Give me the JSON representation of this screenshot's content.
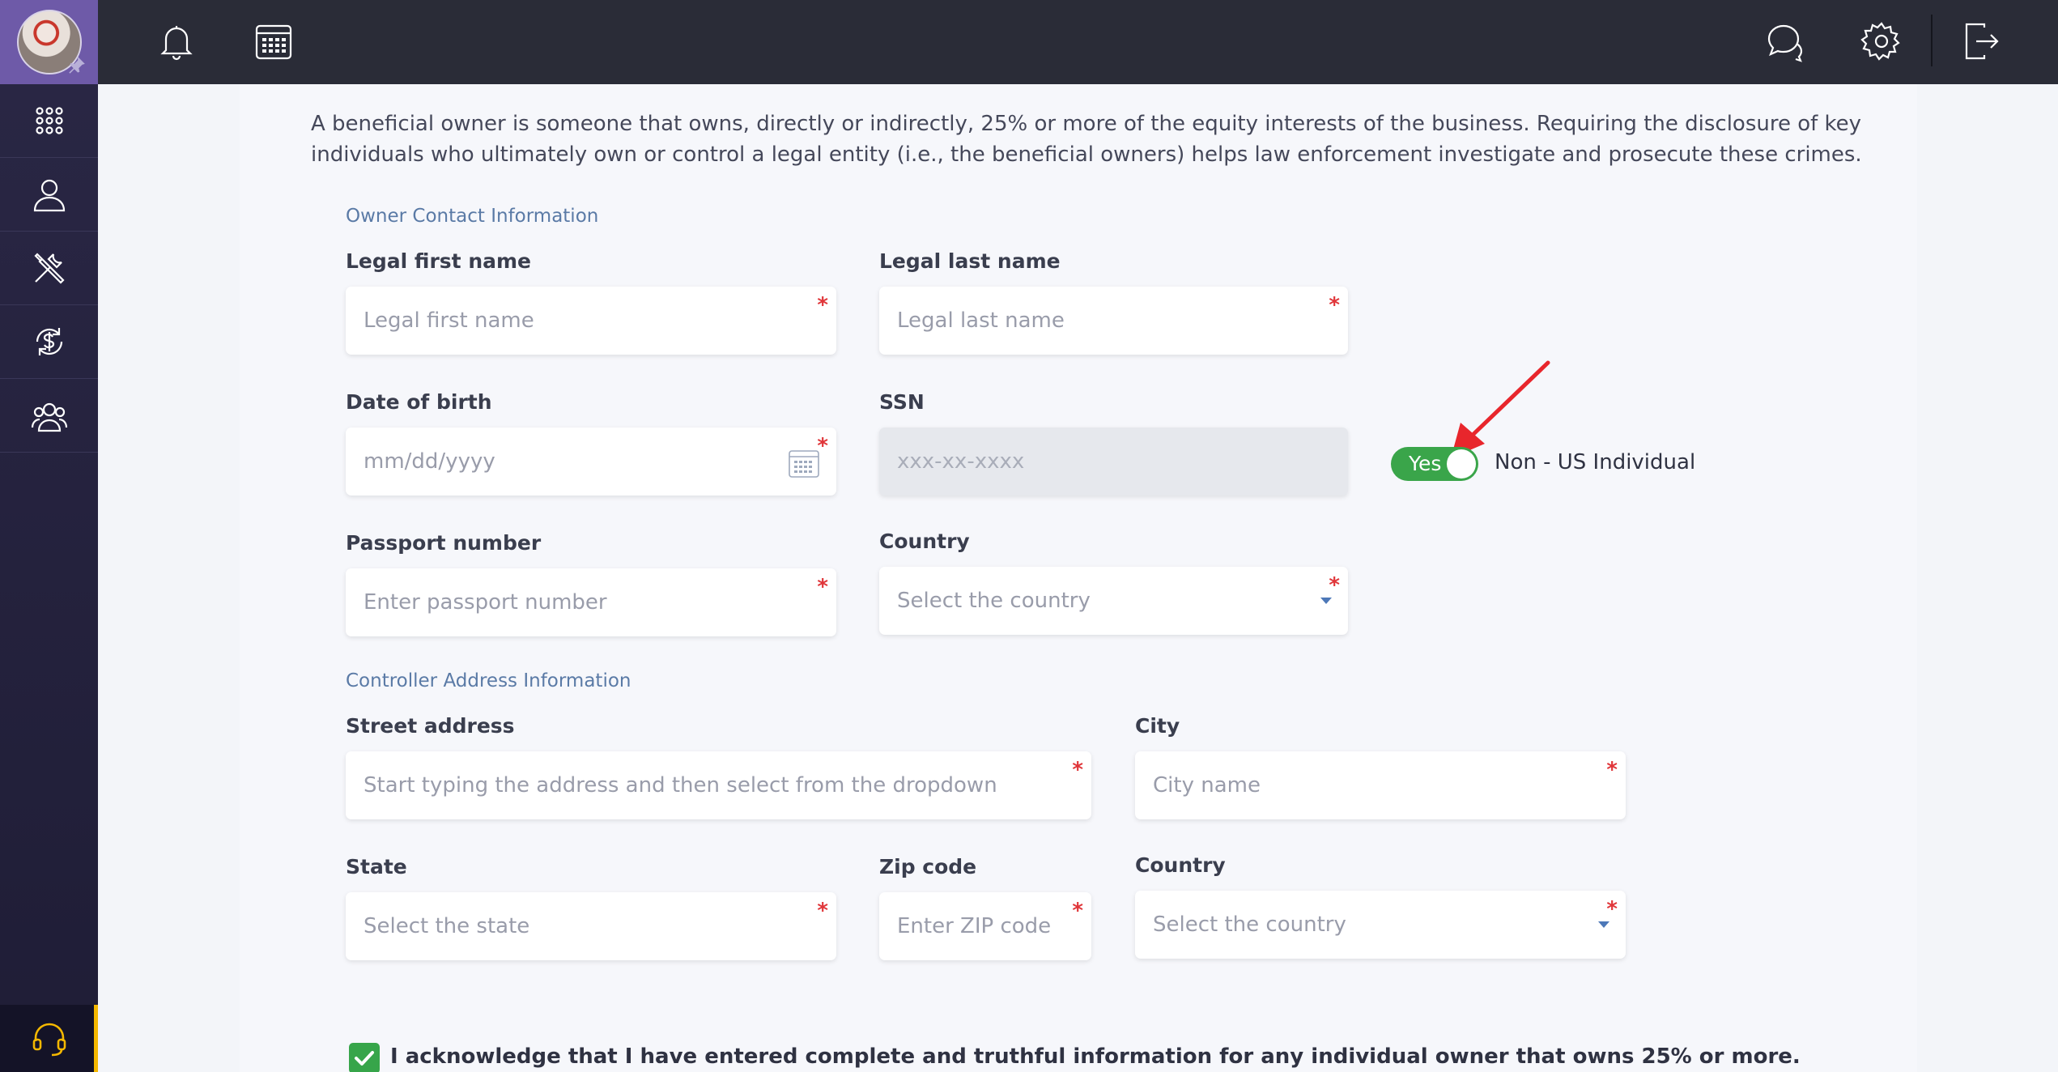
{
  "icons": {
    "notifications": "bell-icon",
    "calendar": "calendar-icon",
    "chat": "chat-icon",
    "settings": "gear-icon",
    "logout": "logout-icon",
    "apps": "apps-grid-icon",
    "profile": "user-icon",
    "tools": "tools-icon",
    "payments": "dollar-refresh-icon",
    "team": "users-icon",
    "support": "headset-icon"
  },
  "colors": {
    "accent": "#3aa54a",
    "section": "#5a7aa6",
    "required": "#e0363a"
  },
  "intro": "A beneficial owner is someone that owns, directly or indirectly, 25% or more of the equity interests of the business. Requiring the disclosure of key individuals who ultimately own or control a legal entity (i.e., the beneficial owners) helps law enforcement investigate and prosecute these crimes.",
  "owner_section": {
    "title": "Owner Contact Information",
    "first_name": {
      "label": "Legal first name",
      "placeholder": "Legal first name",
      "required": "*"
    },
    "last_name": {
      "label": "Legal last name",
      "placeholder": "Legal last name",
      "required": "*"
    },
    "dob": {
      "label": "Date of birth",
      "placeholder": "mm/dd/yyyy",
      "required": "*"
    },
    "ssn": {
      "label": "SSN",
      "placeholder": "xxx-xx-xxxx"
    },
    "non_us": {
      "toggle_text": "Yes",
      "label": "Non - US Individual",
      "on": true
    },
    "passport": {
      "label": "Passport number",
      "placeholder": "Enter passport number",
      "required": "*"
    },
    "country": {
      "label": "Country",
      "placeholder": "Select the country",
      "required": "*"
    }
  },
  "address_section": {
    "title": "Controller Address Information",
    "street": {
      "label": "Street address",
      "placeholder": "Start typing the address and then select from the dropdown",
      "required": "*"
    },
    "city": {
      "label": "City",
      "placeholder": "City name",
      "required": "*"
    },
    "state": {
      "label": "State",
      "placeholder": "Select the state",
      "required": "*"
    },
    "zip": {
      "label": "Zip code",
      "placeholder": "Enter ZIP code",
      "required": "*"
    },
    "country": {
      "label": "Country",
      "placeholder": "Select the country",
      "required": "*"
    }
  },
  "acknowledge": {
    "checked": true,
    "text": "I acknowledge that I have entered complete and truthful information for any individual owner that owns 25% or more."
  }
}
